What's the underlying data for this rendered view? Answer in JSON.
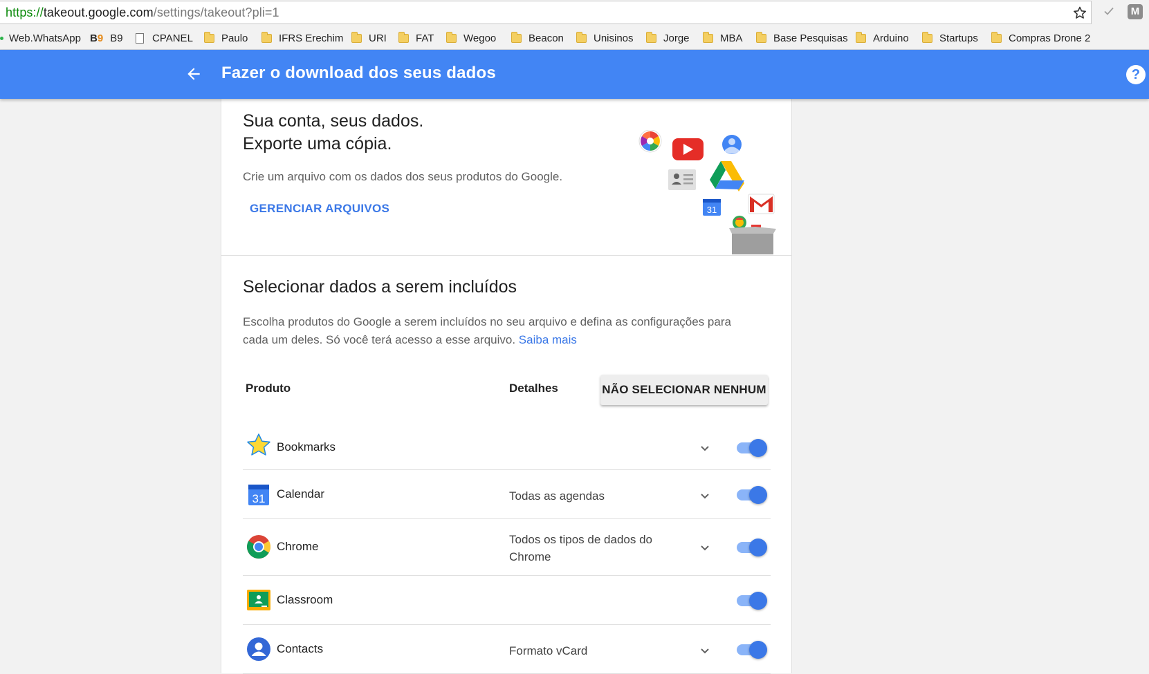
{
  "browser": {
    "url_scheme": "https://",
    "url_host": "takeout.google.com",
    "url_path": "/settings/takeout?pli=1",
    "bookmarks": [
      "Web.WhatsApp",
      "B9",
      "CPANEL",
      "Paulo",
      "IFRS Erechim",
      "URI",
      "FAT",
      "Wegoo",
      "Beacon",
      "Unisinos",
      "Jorge",
      "MBA",
      "Base Pesquisas",
      "Arduino",
      "Startups",
      "Compras Drone 2"
    ]
  },
  "appbar": {
    "title": "Fazer o download dos seus dados",
    "help_glyph": "?"
  },
  "hero": {
    "title_line1": "Sua conta, seus dados.",
    "title_line2": "Exporte uma cópia.",
    "description": "Crie um arquivo com os dados dos seus produtos do Google.",
    "manage_link": "GERENCIAR ARQUIVOS"
  },
  "selection": {
    "title": "Selecionar dados a serem incluídos",
    "description": "Escolha produtos do Google a serem incluídos no seu arquivo e defina as configurações para cada um deles. Só você terá acesso a esse arquivo.",
    "learn_more": "Saiba mais",
    "col_product": "Produto",
    "col_details": "Detalhes",
    "deselect_all_button": "NÃO SELECIONAR NENHUM"
  },
  "products": [
    {
      "name": "Bookmarks",
      "details": "",
      "has_options": true,
      "enabled": true,
      "icon": "star-icon"
    },
    {
      "name": "Calendar",
      "details": "Todas as agendas",
      "has_options": true,
      "enabled": true,
      "icon": "calendar-icon"
    },
    {
      "name": "Chrome",
      "details": "Todos os tipos de dados do Chrome",
      "has_options": true,
      "enabled": true,
      "icon": "chrome-icon"
    },
    {
      "name": "Classroom",
      "details": "",
      "has_options": false,
      "enabled": true,
      "icon": "classroom-icon"
    },
    {
      "name": "Contacts",
      "details": "Formato vCard",
      "has_options": true,
      "enabled": true,
      "icon": "contacts-icon"
    }
  ],
  "calendar_icon_text": "31",
  "colors": {
    "appbar": "#4285f4",
    "link": "#3b78e7",
    "toggle_on": "#3b78e7",
    "toggle_track": "#8ab4f8"
  }
}
